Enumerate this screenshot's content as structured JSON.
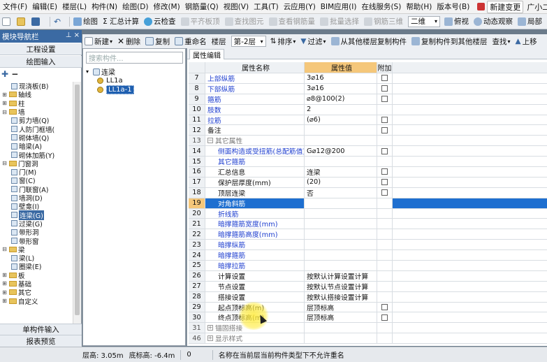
{
  "menu": {
    "items": [
      "文件(F)",
      "编辑(E)",
      "楼层(L)",
      "构件(N)",
      "绘图(D)",
      "修改(M)",
      "钢筋量(Q)",
      "视图(V)",
      "工具(T)",
      "云应用(Y)",
      "BIM应用(I)",
      "在线服务(S)",
      "帮助(H)",
      "版本号(B)"
    ],
    "new_change": "新建变更",
    "user": "广小二"
  },
  "toolbar1": {
    "draw": "绘图",
    "summary": "Σ 汇总计算",
    "cloud_check": "云检查",
    "flat_board": "平齐板顶",
    "find_element": "查找图元",
    "view_rebar": "查看钢筋量",
    "batch_select": "批量选择",
    "rebar_3d": "钢筋三维",
    "view_mode": "二维",
    "top_view": "俯视",
    "dynamic_view": "动态观察",
    "partial": "局部"
  },
  "toolbar2": {
    "new": "新建",
    "delete": "删除",
    "copy": "复制",
    "rename": "重命名",
    "floor_label": "楼层",
    "floor_value": "第-2层",
    "sort": "排序",
    "filter": "过滤",
    "copy_from_other": "从其他楼层复制构件",
    "copy_to_other": "复制构件到其他楼层",
    "find": "查找",
    "move_up": "上移"
  },
  "left_panel": {
    "title": "模块导航栏",
    "project_settings": "工程设置",
    "drawing_input": "绘图输入",
    "single_input": "单构件输入",
    "report_preview": "报表预览",
    "tree": [
      {
        "level": 1,
        "type": "item",
        "label": "现浇板(B)",
        "selected": false
      },
      {
        "level": 0,
        "type": "folder",
        "label": "轴线",
        "expand": "+",
        "selected": false
      },
      {
        "level": 0,
        "type": "folder",
        "label": "柱",
        "expand": "+",
        "selected": false
      },
      {
        "level": 0,
        "type": "folder",
        "label": "墙",
        "expand": "−",
        "selected": false
      },
      {
        "level": 1,
        "type": "item",
        "label": "剪力墙(Q)",
        "selected": false
      },
      {
        "level": 1,
        "type": "item",
        "label": "人防门框墙(",
        "selected": false
      },
      {
        "level": 1,
        "type": "item",
        "label": "砌体墙(Q)",
        "selected": false
      },
      {
        "level": 1,
        "type": "item",
        "label": "暗梁(A)",
        "selected": false
      },
      {
        "level": 1,
        "type": "item",
        "label": "砌体加筋(Y)",
        "selected": false
      },
      {
        "level": 0,
        "type": "folder",
        "label": "门窗洞",
        "expand": "−",
        "selected": false
      },
      {
        "level": 1,
        "type": "item",
        "label": "门(M)",
        "selected": false
      },
      {
        "level": 1,
        "type": "item",
        "label": "窗(C)",
        "selected": false
      },
      {
        "level": 1,
        "type": "item",
        "label": "门联窗(A)",
        "selected": false
      },
      {
        "level": 1,
        "type": "item",
        "label": "墙洞(D)",
        "selected": false
      },
      {
        "level": 1,
        "type": "item",
        "label": "壁龛(I)",
        "selected": false
      },
      {
        "level": 1,
        "type": "item",
        "label": "连梁(G)",
        "selected": true
      },
      {
        "level": 1,
        "type": "item",
        "label": "过梁(G)",
        "selected": false
      },
      {
        "level": 1,
        "type": "item",
        "label": "带形洞",
        "selected": false
      },
      {
        "level": 1,
        "type": "item",
        "label": "带形窗",
        "selected": false
      },
      {
        "level": 0,
        "type": "folder",
        "label": "梁",
        "expand": "−",
        "selected": false
      },
      {
        "level": 1,
        "type": "item",
        "label": "梁(L)",
        "selected": false
      },
      {
        "level": 1,
        "type": "item",
        "label": "圈梁(E)",
        "selected": false
      },
      {
        "level": 0,
        "type": "folder",
        "label": "板",
        "expand": "+",
        "selected": false
      },
      {
        "level": 0,
        "type": "folder",
        "label": "基础",
        "expand": "+",
        "selected": false
      },
      {
        "level": 0,
        "type": "folder",
        "label": "其它",
        "expand": "+",
        "selected": false
      },
      {
        "level": 0,
        "type": "folder",
        "label": "自定义",
        "expand": "+",
        "selected": false
      }
    ]
  },
  "component_panel": {
    "search_placeholder": "搜索构件...",
    "root": "连梁",
    "items": [
      {
        "label": "LL1a",
        "selected": false
      },
      {
        "label": "LL1a-1",
        "selected": true
      }
    ]
  },
  "property_panel": {
    "tab": "属性编辑",
    "headers": {
      "num": "",
      "name": "属性名称",
      "value": "属性值",
      "add": "附加"
    },
    "rows": [
      {
        "num": "7",
        "name": "上部纵筋",
        "value": "3⌀16",
        "blue": true,
        "indent": false,
        "check": true,
        "group": false,
        "active": false
      },
      {
        "num": "8",
        "name": "下部纵筋",
        "value": "3⌀16",
        "blue": true,
        "indent": false,
        "check": true,
        "group": false,
        "active": false
      },
      {
        "num": "9",
        "name": "箍筋",
        "value": "⌀8@100(2)",
        "blue": true,
        "indent": false,
        "check": true,
        "group": false,
        "active": false
      },
      {
        "num": "10",
        "name": "肢数",
        "value": "2",
        "blue": true,
        "indent": false,
        "check": false,
        "group": false,
        "active": false
      },
      {
        "num": "11",
        "name": "拉筋",
        "value": "(⌀6)",
        "blue": true,
        "indent": false,
        "check": true,
        "group": false,
        "active": false
      },
      {
        "num": "12",
        "name": "备注",
        "value": "",
        "blue": false,
        "indent": false,
        "check": true,
        "group": false,
        "active": false
      },
      {
        "num": "13",
        "name": "其它属性",
        "value": "",
        "blue": false,
        "indent": false,
        "check": false,
        "group": true,
        "expand": "−",
        "active": false
      },
      {
        "num": "14",
        "name": "侧面构造或受扭筋(总配筋值)",
        "value": "G⌀12@200",
        "blue": true,
        "indent": true,
        "check": true,
        "group": false,
        "active": false
      },
      {
        "num": "15",
        "name": "其它箍筋",
        "value": "",
        "blue": true,
        "indent": true,
        "check": false,
        "group": false,
        "active": false
      },
      {
        "num": "16",
        "name": "汇总信息",
        "value": "连梁",
        "blue": false,
        "indent": true,
        "check": true,
        "group": false,
        "active": false
      },
      {
        "num": "17",
        "name": "保护层厚度(mm)",
        "value": "(20)",
        "blue": false,
        "indent": true,
        "check": true,
        "group": false,
        "active": false
      },
      {
        "num": "18",
        "name": "顶层连梁",
        "value": "否",
        "blue": false,
        "indent": true,
        "check": true,
        "group": false,
        "active": false
      },
      {
        "num": "19",
        "name": "对角斜筋",
        "value": "",
        "blue": false,
        "indent": true,
        "check": false,
        "group": false,
        "active": true
      },
      {
        "num": "20",
        "name": "折线筋",
        "value": "",
        "blue": true,
        "indent": true,
        "check": false,
        "group": false,
        "active": false
      },
      {
        "num": "21",
        "name": "暗撑箍筋宽度(mm)",
        "value": "",
        "blue": true,
        "indent": true,
        "check": false,
        "group": false,
        "active": false
      },
      {
        "num": "22",
        "name": "暗撑箍筋高度(mm)",
        "value": "",
        "blue": true,
        "indent": true,
        "check": false,
        "group": false,
        "active": false
      },
      {
        "num": "23",
        "name": "暗撑纵筋",
        "value": "",
        "blue": true,
        "indent": true,
        "check": false,
        "group": false,
        "active": false
      },
      {
        "num": "24",
        "name": "暗撑箍筋",
        "value": "",
        "blue": true,
        "indent": true,
        "check": false,
        "group": false,
        "active": false
      },
      {
        "num": "25",
        "name": "暗撑拉筋",
        "value": "",
        "blue": true,
        "indent": true,
        "check": false,
        "group": false,
        "active": false
      },
      {
        "num": "26",
        "name": "计算设置",
        "value": "按默认计算设置计算",
        "blue": false,
        "indent": true,
        "check": false,
        "group": false,
        "active": false
      },
      {
        "num": "27",
        "name": "节点设置",
        "value": "按默认节点设置计算",
        "blue": false,
        "indent": true,
        "check": false,
        "group": false,
        "active": false
      },
      {
        "num": "28",
        "name": "搭接设置",
        "value": "按默认搭接设置计算",
        "blue": false,
        "indent": true,
        "check": false,
        "group": false,
        "active": false
      },
      {
        "num": "29",
        "name": "起点顶标高(m)",
        "value": "层顶标高",
        "blue": false,
        "indent": true,
        "check": true,
        "group": false,
        "active": false
      },
      {
        "num": "30",
        "name": "终点顶标高(m)",
        "value": "层顶标高",
        "blue": false,
        "indent": true,
        "check": true,
        "group": false,
        "active": false
      },
      {
        "num": "31",
        "name": "锚固搭接",
        "value": "",
        "blue": false,
        "indent": false,
        "check": false,
        "group": true,
        "expand": "+",
        "active": false
      },
      {
        "num": "46",
        "name": "显示样式",
        "value": "",
        "blue": false,
        "indent": false,
        "check": false,
        "group": true,
        "expand": "+",
        "active": false
      }
    ]
  },
  "status": {
    "floor_height": "层高: 3.05m",
    "base_elevation": "底标高: -6.4m",
    "count": "0",
    "message": "名称在当前层当前构件类型下不允许重名"
  },
  "colors": {
    "title_blue": "#3b6aa3",
    "selection_blue": "#1e6fd0",
    "header_orange": "#f5c77a",
    "link_blue": "#1f3fcf"
  }
}
